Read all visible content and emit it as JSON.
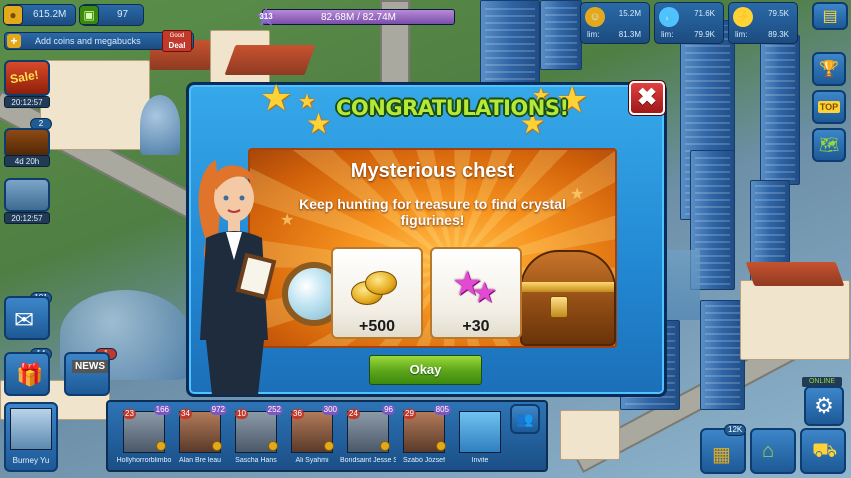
{
  "colors": {
    "dialog_blue": "#2287d2",
    "title_green": "#b4e83a",
    "panel_orange": "#f6921e",
    "button_green": "#5fa81c",
    "close_red": "#c62828"
  },
  "top_bar": {
    "money": "615.2M",
    "money_icon": "coins-icon",
    "megabucks": "97",
    "megabucks_icon": "megabucks-icon",
    "add_currency_label": "Add coins and megabucks",
    "deal_badge": "Deal",
    "deal_badge_top": "Good",
    "level": "313",
    "xp_text": "82.68M / 82.74M",
    "xp_fraction": 0.999,
    "population": {
      "value": "15.2M",
      "lim": "81.3M",
      "icon": "population-icon"
    },
    "water": {
      "value": "71.6K",
      "lim": "79.9K",
      "icon": "water-drop-icon"
    },
    "power": {
      "value": "79.5K",
      "lim": "89.3K",
      "icon": "lightning-icon"
    },
    "lim_label": "lim:"
  },
  "left_column": {
    "sale_badge": "Sale!",
    "sale_timer": "20:12:57",
    "chest_count": "2",
    "chest_timer": "4d 20h",
    "building_timer": "20:12:57",
    "mail_count": "101",
    "gift_count": "14",
    "news_count": "1",
    "news_label": "NEWS"
  },
  "dialog": {
    "title": "CONGRATULATIONS!",
    "panel_title": "Mysterious chest",
    "description": "Keep hunting for treasure to find crystal figurines!",
    "rewards": [
      {
        "amount": "+500",
        "icon": "gold-coins-icon"
      },
      {
        "amount": "+30",
        "icon": "pink-stars-icon"
      }
    ],
    "okay_label": "Okay",
    "close_icon": "close-x-icon"
  },
  "friends": {
    "self_name": "Burney Yu",
    "items": [
      {
        "name": "Hollyhorrorblimbo",
        "level": "23",
        "stars": "166"
      },
      {
        "name": "Alan Bre leau",
        "level": "34",
        "stars": "972"
      },
      {
        "name": "Sascha Hans",
        "level": "10",
        "stars": "252"
      },
      {
        "name": "Ali Syahmi",
        "level": "36",
        "stars": "300"
      },
      {
        "name": "Bondsaint Jesse Santi",
        "level": "24",
        "stars": "96"
      },
      {
        "name": "Szabó József",
        "level": "29",
        "stars": "805"
      }
    ],
    "invite_label": "Invite"
  },
  "right_column": {
    "icons": [
      "inventory-icon",
      "trophy-icon",
      "top-icon",
      "map-icon"
    ],
    "top_label": "TOP",
    "online_label": "ONLINE",
    "bottom_count": "12K",
    "bottom_icons": [
      "shop-icon",
      "build-icon",
      "bulldozer-icon"
    ]
  }
}
